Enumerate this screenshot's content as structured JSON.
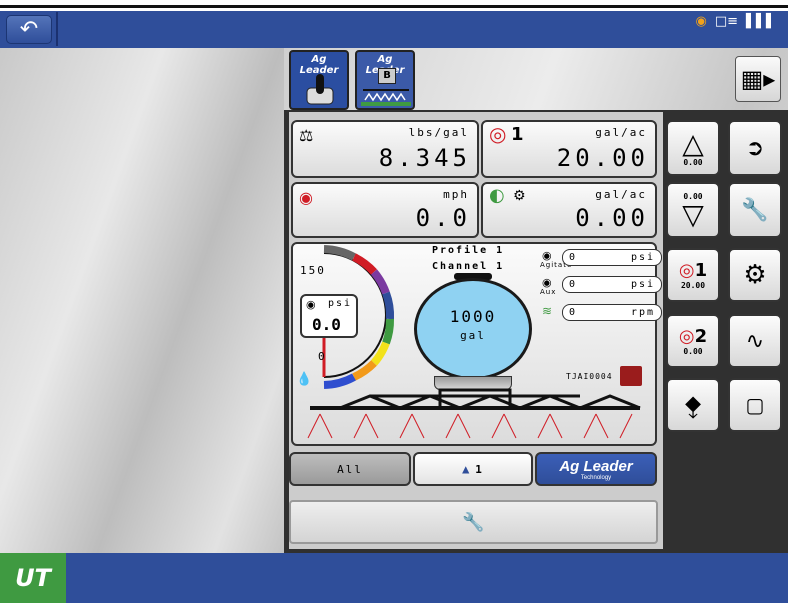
{
  "apps": [
    {
      "label": "Ag Leader"
    },
    {
      "label": "Ag Leader",
      "badge": "B"
    }
  ],
  "status": {
    "icons": [
      "ag-leader-gps-icon",
      "display-connection-icon",
      "signal-strength-icon"
    ]
  },
  "panels": {
    "application_rate": {
      "unit": "lbs/gal",
      "value": "8.345"
    },
    "target_rate": {
      "unit": "gal/ac",
      "value": "20.00",
      "product_number": "1"
    },
    "speed": {
      "unit": "mph",
      "value": "0.0"
    },
    "actual_rate": {
      "unit": "gal/ac",
      "value": "0.00"
    }
  },
  "gauge": {
    "max_label": "150",
    "min_label": "0",
    "pressure_unit": "psi",
    "pressure_value": "0.0"
  },
  "profile": {
    "profile_label": "Profile 1",
    "channel_label": "Channel 1"
  },
  "readouts": [
    {
      "sublabel": "Agitate",
      "value": "0",
      "unit": "psi"
    },
    {
      "sublabel": "Aux",
      "value": "0",
      "unit": "psi"
    },
    {
      "sublabel": "",
      "value": "0",
      "unit": "rpm"
    }
  ],
  "tank": {
    "value": "1000",
    "unit": "gal"
  },
  "nozzle": {
    "label": "TJAI0004"
  },
  "right_buttons": {
    "rate_up_value": "0.00",
    "rate_down_value": "0.00",
    "product1_label": "1",
    "product1_value": "20.00",
    "product2_label": "2",
    "product2_value": "0.00"
  },
  "bottom_tabs": {
    "all_label": "All",
    "boom_label": "1",
    "brand_label": "Ag Leader",
    "brand_sub": "Technology"
  },
  "bottom_logo": "UT",
  "colors": {
    "header": "#2f4e9a",
    "accent_green": "#3f9a41",
    "tank_fill": "#8fd2f2",
    "target_red": "#d01c25"
  }
}
